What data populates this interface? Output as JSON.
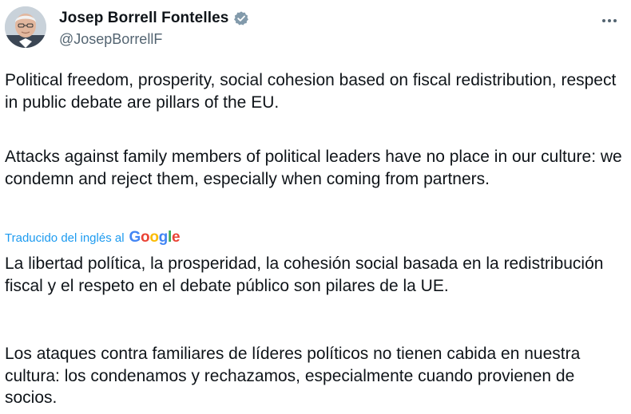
{
  "author": {
    "display_name": "Josep Borrell Fontelles",
    "handle": "@JosepBorrellF",
    "verified": true,
    "verified_color": "#829aab"
  },
  "icons": {
    "avatar": "profile-photo",
    "verified": "verified-badge-icon",
    "more": "more-options-icon"
  },
  "tweet": {
    "original_paragraphs": [
      "Political freedom, prosperity, social cohesion based on fiscal redistribution, respect in public debate are pillars of the EU.",
      "Attacks against family members of political leaders have no place in our culture: we condemn and reject them, especially when coming from partners."
    ],
    "translation_label": "Traducido del inglés al",
    "translation_provider": "Google",
    "translated_paragraphs": [
      "La libertad política, la prosperidad, la cohesión social basada en la redistribución fiscal y el respeto en el debate público son pilares de la UE.",
      "Los ataques contra familiares de líderes políticos no tienen cabida en nuestra cultura: los condenamos y rechazamos, especialmente cuando provienen de socios."
    ]
  },
  "colors": {
    "text": "#0f1419",
    "secondary": "#536471",
    "link": "#1d9bf0"
  }
}
